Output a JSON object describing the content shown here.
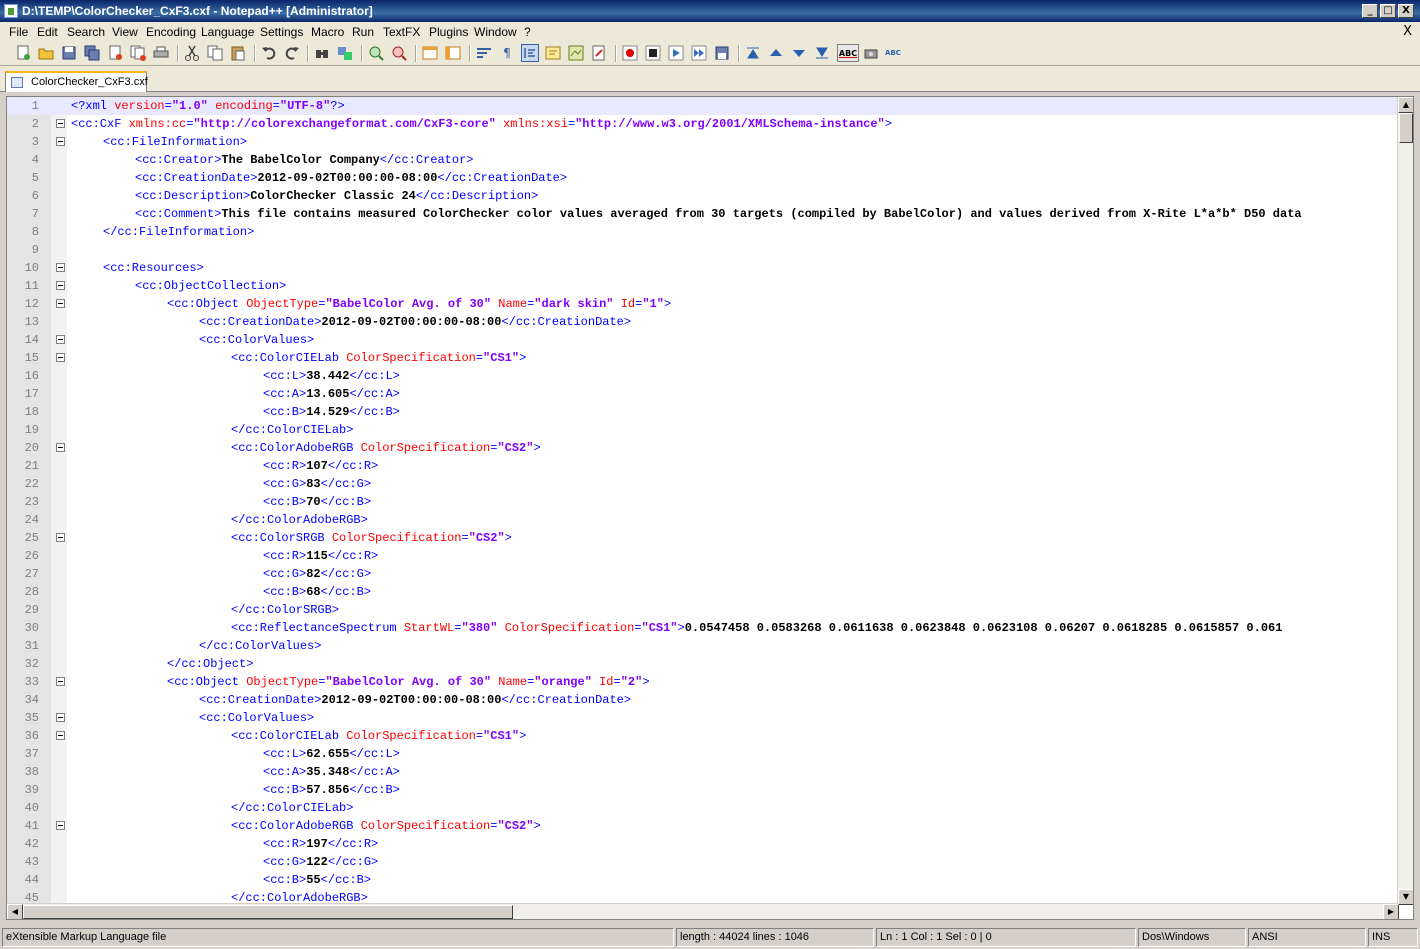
{
  "window": {
    "title": "D:\\TEMP\\ColorChecker_CxF3.cxf - Notepad++ [Administrator]",
    "minimize": "_",
    "maximize": "□",
    "close": "X"
  },
  "menu": {
    "items": [
      "File",
      "Edit",
      "Search",
      "View",
      "Encoding",
      "Language",
      "Settings",
      "Macro",
      "Run",
      "TextFX",
      "Plugins",
      "Window",
      "?"
    ],
    "doc_close": "X"
  },
  "toolbar": {
    "icons": [
      "new-file-icon",
      "open-file-icon",
      "save-icon",
      "save-all-icon",
      "close-icon",
      "close-all-icon",
      "print-icon",
      "cut-icon",
      "copy-icon",
      "paste-icon",
      "undo-icon",
      "redo-icon",
      "find-icon",
      "replace-icon",
      "zoom-in-icon",
      "zoom-out-icon",
      "sync-vertical-icon",
      "sync-horizontal-icon",
      "word-wrap-icon",
      "show-all-chars-icon",
      "indent-guide-icon",
      "udl-icon",
      "doc-map-icon",
      "function-list-icon",
      "record-macro-icon",
      "stop-record-icon",
      "play-macro-icon",
      "run-multiple-macro-icon",
      "save-macro-icon",
      "textfx-collapse-icon",
      "textfx-up-icon",
      "textfx-down-icon",
      "textfx-expand-icon",
      "spell-check-icon",
      "spell-options-icon",
      "spell-auto-icon"
    ]
  },
  "tabs": [
    {
      "label": "ColorChecker_CxF3.cxf"
    }
  ],
  "colors": {
    "tag": "#0000ff",
    "attribute": "#ff0000",
    "value": "#8000ff",
    "text": "#000000",
    "current_line": "#e8e8ff"
  },
  "editor": {
    "lines": [
      {
        "n": "1",
        "fold": false,
        "current": true,
        "indent": 0,
        "tokens": [
          [
            "p",
            "<?xml "
          ],
          [
            "a",
            "version"
          ],
          [
            "p",
            "="
          ],
          [
            "v",
            "\"1.0\""
          ],
          [
            "p",
            " "
          ],
          [
            "a",
            "encoding"
          ],
          [
            "p",
            "="
          ],
          [
            "v",
            "\"UTF-8\""
          ],
          [
            "p",
            "?>"
          ]
        ]
      },
      {
        "n": "2",
        "fold": true,
        "indent": 0,
        "tokens": [
          [
            "t",
            "<cc:CxF "
          ],
          [
            "a",
            "xmlns:cc"
          ],
          [
            "t",
            "="
          ],
          [
            "v",
            "\"http://colorexchangeformat.com/CxF3-core\""
          ],
          [
            "t",
            " "
          ],
          [
            "a",
            "xmlns:xsi"
          ],
          [
            "t",
            "="
          ],
          [
            "v",
            "\"http://www.w3.org/2001/XMLSchema-instance\""
          ],
          [
            "t",
            ">"
          ]
        ]
      },
      {
        "n": "3",
        "fold": true,
        "indent": 1,
        "tokens": [
          [
            "t",
            "<cc:FileInformation>"
          ]
        ]
      },
      {
        "n": "4",
        "fold": false,
        "indent": 2,
        "tokens": [
          [
            "t",
            "<cc:Creator>"
          ],
          [
            "c",
            "The BabelColor Company"
          ],
          [
            "t",
            "</cc:Creator>"
          ]
        ]
      },
      {
        "n": "5",
        "fold": false,
        "indent": 2,
        "tokens": [
          [
            "t",
            "<cc:CreationDate>"
          ],
          [
            "c",
            "2012-09-02T00:00:00-08:00"
          ],
          [
            "t",
            "</cc:CreationDate>"
          ]
        ]
      },
      {
        "n": "6",
        "fold": false,
        "indent": 2,
        "tokens": [
          [
            "t",
            "<cc:Description>"
          ],
          [
            "c",
            "ColorChecker Classic 24"
          ],
          [
            "t",
            "</cc:Description>"
          ]
        ]
      },
      {
        "n": "7",
        "fold": false,
        "indent": 2,
        "tokens": [
          [
            "t",
            "<cc:Comment>"
          ],
          [
            "c",
            "This file contains measured ColorChecker color values averaged from 30 targets (compiled by BabelColor) and values derived from X-Rite L*a*b* D50 data"
          ]
        ]
      },
      {
        "n": "8",
        "fold": false,
        "indent": 1,
        "tokens": [
          [
            "t",
            "</cc:FileInformation>"
          ]
        ]
      },
      {
        "n": "9",
        "fold": false,
        "indent": 0,
        "tokens": []
      },
      {
        "n": "10",
        "fold": true,
        "indent": 1,
        "tokens": [
          [
            "t",
            "<cc:Resources>"
          ]
        ]
      },
      {
        "n": "11",
        "fold": true,
        "indent": 2,
        "tokens": [
          [
            "t",
            "<cc:ObjectCollection>"
          ]
        ]
      },
      {
        "n": "12",
        "fold": true,
        "indent": 3,
        "tokens": [
          [
            "t",
            "<cc:Object "
          ],
          [
            "a",
            "ObjectType"
          ],
          [
            "t",
            "="
          ],
          [
            "v",
            "\"BabelColor Avg. of 30\""
          ],
          [
            "t",
            " "
          ],
          [
            "a",
            "Name"
          ],
          [
            "t",
            "="
          ],
          [
            "v",
            "\"dark skin\""
          ],
          [
            "t",
            " "
          ],
          [
            "a",
            "Id"
          ],
          [
            "t",
            "="
          ],
          [
            "v",
            "\"1\""
          ],
          [
            "t",
            ">"
          ]
        ]
      },
      {
        "n": "13",
        "fold": false,
        "indent": 4,
        "tokens": [
          [
            "t",
            "<cc:CreationDate>"
          ],
          [
            "c",
            "2012-09-02T00:00:00-08:00"
          ],
          [
            "t",
            "</cc:CreationDate>"
          ]
        ]
      },
      {
        "n": "14",
        "fold": true,
        "indent": 4,
        "tokens": [
          [
            "t",
            "<cc:ColorValues>"
          ]
        ]
      },
      {
        "n": "15",
        "fold": true,
        "indent": 5,
        "tokens": [
          [
            "t",
            "<cc:ColorCIELab "
          ],
          [
            "a",
            "ColorSpecification"
          ],
          [
            "t",
            "="
          ],
          [
            "v",
            "\"CS1\""
          ],
          [
            "t",
            ">"
          ]
        ]
      },
      {
        "n": "16",
        "fold": false,
        "indent": 6,
        "tokens": [
          [
            "t",
            "<cc:L>"
          ],
          [
            "c",
            "38.442"
          ],
          [
            "t",
            "</cc:L>"
          ]
        ]
      },
      {
        "n": "17",
        "fold": false,
        "indent": 6,
        "tokens": [
          [
            "t",
            "<cc:A>"
          ],
          [
            "c",
            "13.605"
          ],
          [
            "t",
            "</cc:A>"
          ]
        ]
      },
      {
        "n": "18",
        "fold": false,
        "indent": 6,
        "tokens": [
          [
            "t",
            "<cc:B>"
          ],
          [
            "c",
            "14.529"
          ],
          [
            "t",
            "</cc:B>"
          ]
        ]
      },
      {
        "n": "19",
        "fold": false,
        "indent": 5,
        "tokens": [
          [
            "t",
            "</cc:ColorCIELab>"
          ]
        ]
      },
      {
        "n": "20",
        "fold": true,
        "indent": 5,
        "tokens": [
          [
            "t",
            "<cc:ColorAdobeRGB "
          ],
          [
            "a",
            "ColorSpecification"
          ],
          [
            "t",
            "="
          ],
          [
            "v",
            "\"CS2\""
          ],
          [
            "t",
            ">"
          ]
        ]
      },
      {
        "n": "21",
        "fold": false,
        "indent": 6,
        "tokens": [
          [
            "t",
            "<cc:R>"
          ],
          [
            "c",
            "107"
          ],
          [
            "t",
            "</cc:R>"
          ]
        ]
      },
      {
        "n": "22",
        "fold": false,
        "indent": 6,
        "tokens": [
          [
            "t",
            "<cc:G>"
          ],
          [
            "c",
            "83"
          ],
          [
            "t",
            "</cc:G>"
          ]
        ]
      },
      {
        "n": "23",
        "fold": false,
        "indent": 6,
        "tokens": [
          [
            "t",
            "<cc:B>"
          ],
          [
            "c",
            "70"
          ],
          [
            "t",
            "</cc:B>"
          ]
        ]
      },
      {
        "n": "24",
        "fold": false,
        "indent": 5,
        "tokens": [
          [
            "t",
            "</cc:ColorAdobeRGB>"
          ]
        ]
      },
      {
        "n": "25",
        "fold": true,
        "indent": 5,
        "tokens": [
          [
            "t",
            "<cc:ColorSRGB "
          ],
          [
            "a",
            "ColorSpecification"
          ],
          [
            "t",
            "="
          ],
          [
            "v",
            "\"CS2\""
          ],
          [
            "t",
            ">"
          ]
        ]
      },
      {
        "n": "26",
        "fold": false,
        "indent": 6,
        "tokens": [
          [
            "t",
            "<cc:R>"
          ],
          [
            "c",
            "115"
          ],
          [
            "t",
            "</cc:R>"
          ]
        ]
      },
      {
        "n": "27",
        "fold": false,
        "indent": 6,
        "tokens": [
          [
            "t",
            "<cc:G>"
          ],
          [
            "c",
            "82"
          ],
          [
            "t",
            "</cc:G>"
          ]
        ]
      },
      {
        "n": "28",
        "fold": false,
        "indent": 6,
        "tokens": [
          [
            "t",
            "<cc:B>"
          ],
          [
            "c",
            "68"
          ],
          [
            "t",
            "</cc:B>"
          ]
        ]
      },
      {
        "n": "29",
        "fold": false,
        "indent": 5,
        "tokens": [
          [
            "t",
            "</cc:ColorSRGB>"
          ]
        ]
      },
      {
        "n": "30",
        "fold": false,
        "indent": 5,
        "tokens": [
          [
            "t",
            "<cc:ReflectanceSpectrum "
          ],
          [
            "a",
            "StartWL"
          ],
          [
            "t",
            "="
          ],
          [
            "v",
            "\"380\""
          ],
          [
            "t",
            " "
          ],
          [
            "a",
            "ColorSpecification"
          ],
          [
            "t",
            "="
          ],
          [
            "v",
            "\"CS1\""
          ],
          [
            "t",
            ">"
          ],
          [
            "c",
            "0.0547458 0.0583268 0.0611638 0.0623848 0.0623108 0.06207 0.0618285 0.0615857 0.061"
          ]
        ]
      },
      {
        "n": "31",
        "fold": false,
        "indent": 4,
        "tokens": [
          [
            "t",
            "</cc:ColorValues>"
          ]
        ]
      },
      {
        "n": "32",
        "fold": false,
        "indent": 3,
        "tokens": [
          [
            "t",
            "</cc:Object>"
          ]
        ]
      },
      {
        "n": "33",
        "fold": true,
        "indent": 3,
        "tokens": [
          [
            "t",
            "<cc:Object "
          ],
          [
            "a",
            "ObjectType"
          ],
          [
            "t",
            "="
          ],
          [
            "v",
            "\"BabelColor Avg. of 30\""
          ],
          [
            "t",
            " "
          ],
          [
            "a",
            "Name"
          ],
          [
            "t",
            "="
          ],
          [
            "v",
            "\"orange\""
          ],
          [
            "t",
            " "
          ],
          [
            "a",
            "Id"
          ],
          [
            "t",
            "="
          ],
          [
            "v",
            "\"2\""
          ],
          [
            "t",
            ">"
          ]
        ]
      },
      {
        "n": "34",
        "fold": false,
        "indent": 4,
        "tokens": [
          [
            "t",
            "<cc:CreationDate>"
          ],
          [
            "c",
            "2012-09-02T00:00:00-08:00"
          ],
          [
            "t",
            "</cc:CreationDate>"
          ]
        ]
      },
      {
        "n": "35",
        "fold": true,
        "indent": 4,
        "tokens": [
          [
            "t",
            "<cc:ColorValues>"
          ]
        ]
      },
      {
        "n": "36",
        "fold": true,
        "indent": 5,
        "tokens": [
          [
            "t",
            "<cc:ColorCIELab "
          ],
          [
            "a",
            "ColorSpecification"
          ],
          [
            "t",
            "="
          ],
          [
            "v",
            "\"CS1\""
          ],
          [
            "t",
            ">"
          ]
        ]
      },
      {
        "n": "37",
        "fold": false,
        "indent": 6,
        "tokens": [
          [
            "t",
            "<cc:L>"
          ],
          [
            "c",
            "62.655"
          ],
          [
            "t",
            "</cc:L>"
          ]
        ]
      },
      {
        "n": "38",
        "fold": false,
        "indent": 6,
        "tokens": [
          [
            "t",
            "<cc:A>"
          ],
          [
            "c",
            "35.348"
          ],
          [
            "t",
            "</cc:A>"
          ]
        ]
      },
      {
        "n": "39",
        "fold": false,
        "indent": 6,
        "tokens": [
          [
            "t",
            "<cc:B>"
          ],
          [
            "c",
            "57.856"
          ],
          [
            "t",
            "</cc:B>"
          ]
        ]
      },
      {
        "n": "40",
        "fold": false,
        "indent": 5,
        "tokens": [
          [
            "t",
            "</cc:ColorCIELab>"
          ]
        ]
      },
      {
        "n": "41",
        "fold": true,
        "indent": 5,
        "tokens": [
          [
            "t",
            "<cc:ColorAdobeRGB "
          ],
          [
            "a",
            "ColorSpecification"
          ],
          [
            "t",
            "="
          ],
          [
            "v",
            "\"CS2\""
          ],
          [
            "t",
            ">"
          ]
        ]
      },
      {
        "n": "42",
        "fold": false,
        "indent": 6,
        "tokens": [
          [
            "t",
            "<cc:R>"
          ],
          [
            "c",
            "197"
          ],
          [
            "t",
            "</cc:R>"
          ]
        ]
      },
      {
        "n": "43",
        "fold": false,
        "indent": 6,
        "tokens": [
          [
            "t",
            "<cc:G>"
          ],
          [
            "c",
            "122"
          ],
          [
            "t",
            "</cc:G>"
          ]
        ]
      },
      {
        "n": "44",
        "fold": false,
        "indent": 6,
        "tokens": [
          [
            "t",
            "<cc:B>"
          ],
          [
            "c",
            "55"
          ],
          [
            "t",
            "</cc:B>"
          ]
        ]
      },
      {
        "n": "45",
        "fold": false,
        "indent": 5,
        "tokens": [
          [
            "t",
            "</cc:ColorAdobeRGB>"
          ]
        ]
      }
    ]
  },
  "status": {
    "filetype": "eXtensible Markup Language file",
    "length": "length : 44024    lines : 1046",
    "position": "Ln : 1    Col : 1    Sel : 0 | 0",
    "eol": "Dos\\Windows",
    "encoding": "ANSI",
    "mode": "INS"
  }
}
